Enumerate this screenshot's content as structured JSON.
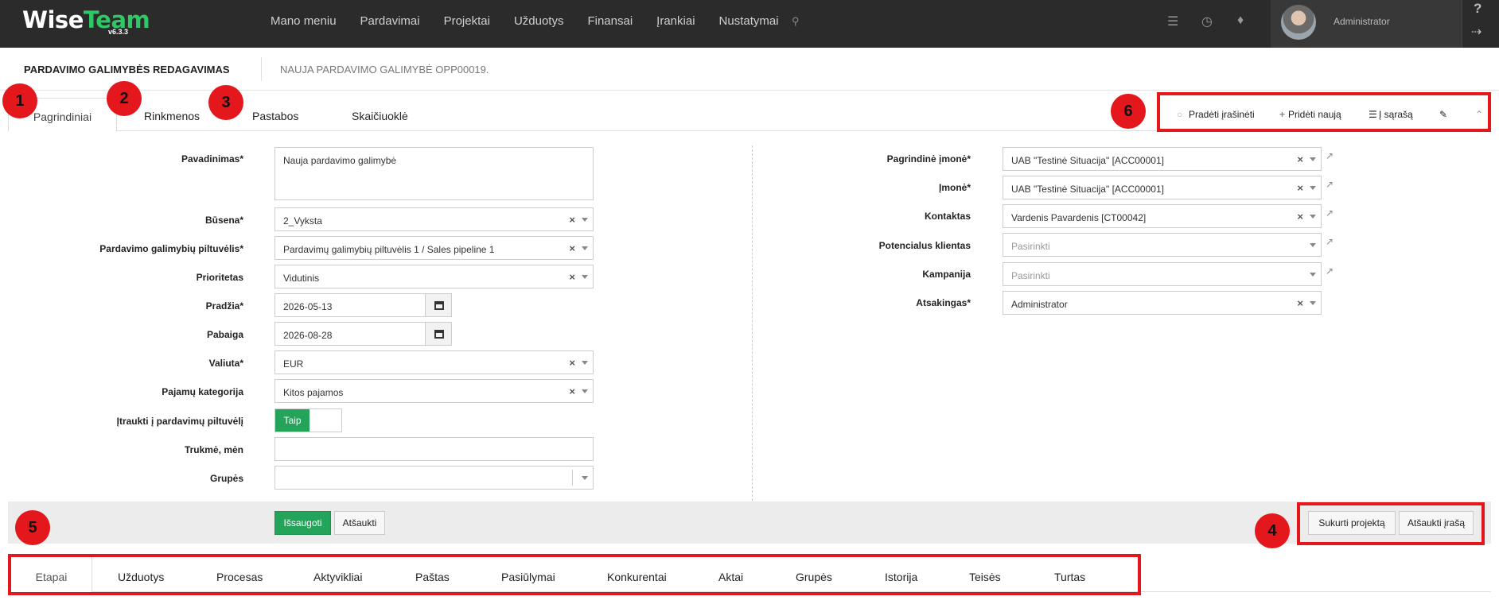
{
  "app": {
    "logo_wise": "Wise",
    "logo_team": "Team",
    "version": "v6.3.3",
    "nav": [
      "Mano meniu",
      "Pardavimai",
      "Projektai",
      "Užduotys",
      "Finansai",
      "Įrankiai",
      "Nustatymai"
    ],
    "user_name": "Administrator",
    "help": "?",
    "icons": [
      "search-icon",
      "server-icon",
      "clock-icon",
      "bell-icon",
      "logout-icon"
    ]
  },
  "page": {
    "title": "PARDAVIMO GALIMYBĖS REDAGAVIMAS",
    "subtitle": "NAUJA PARDAVIMO GALIMYBĖ OPP00019."
  },
  "tabs": [
    "Pagrindiniai",
    "Rinkmenos",
    "Pastabos",
    "Skaičiuoklė"
  ],
  "actions": {
    "start_recording": "Pradėti įrašinėti",
    "add_new": "Pridėti naują",
    "to_list": "Į sąrašą"
  },
  "badges": [
    "1",
    "2",
    "3",
    "4",
    "5",
    "6"
  ],
  "left_form": {
    "name_label": "Pavadinimas*",
    "name_value": "Nauja pardavimo galimybė",
    "status_label": "Būsena*",
    "status_value": "2_Vyksta",
    "pipeline_label": "Pardavimo galimybių piltuvėlis*",
    "pipeline_value": "Pardavimų galimybių piltuvėlis 1 / Sales pipeline 1",
    "priority_label": "Prioritetas",
    "priority_value": "Vidutinis",
    "start_label": "Pradžia*",
    "start_value": "2026-05-13",
    "end_label": "Pabaiga",
    "end_value": "2026-08-28",
    "currency_label": "Valiuta*",
    "currency_value": "EUR",
    "income_label": "Pajamų kategorija",
    "income_value": "Kitos pajamos",
    "include_label": "Įtraukti į pardavimų piltuvėlį",
    "include_value": "Taip",
    "duration_label": "Trukmė, mėn",
    "duration_value": "",
    "groups_label": "Grupės",
    "groups_value": ""
  },
  "right_form": {
    "main_company_label": "Pagrindinė įmonė*",
    "main_company_value": "UAB \"Testinė Situacija\" [ACC00001]",
    "company_label": "Įmonė*",
    "company_value": "UAB \"Testinė Situacija\" [ACC00001]",
    "contact_label": "Kontaktas",
    "contact_value": "Vardenis Pavardenis [CT00042]",
    "potential_label": "Potencialus klientas",
    "potential_placeholder": "Pasirinkti",
    "campaign_label": "Kampanija",
    "campaign_placeholder": "Pasirinkti",
    "responsible_label": "Atsakingas*",
    "responsible_value": "Administrator"
  },
  "buttons": {
    "save": "Išsaugoti",
    "cancel": "Atšaukti",
    "create_project": "Sukurti projektą",
    "cancel_record": "Atšaukti įrašą"
  },
  "bottom_tabs": [
    "Etapai",
    "Užduotys",
    "Procesas",
    "Aktyvikliai",
    "Paštas",
    "Pasiūlymai",
    "Konkurentai",
    "Aktai",
    "Grupės",
    "Istorija",
    "Teisės",
    "Turtas"
  ],
  "colors": {
    "primary_green": "#24a35b",
    "highlight_red": "#e3171c",
    "topbar": "#2b2b2b"
  }
}
